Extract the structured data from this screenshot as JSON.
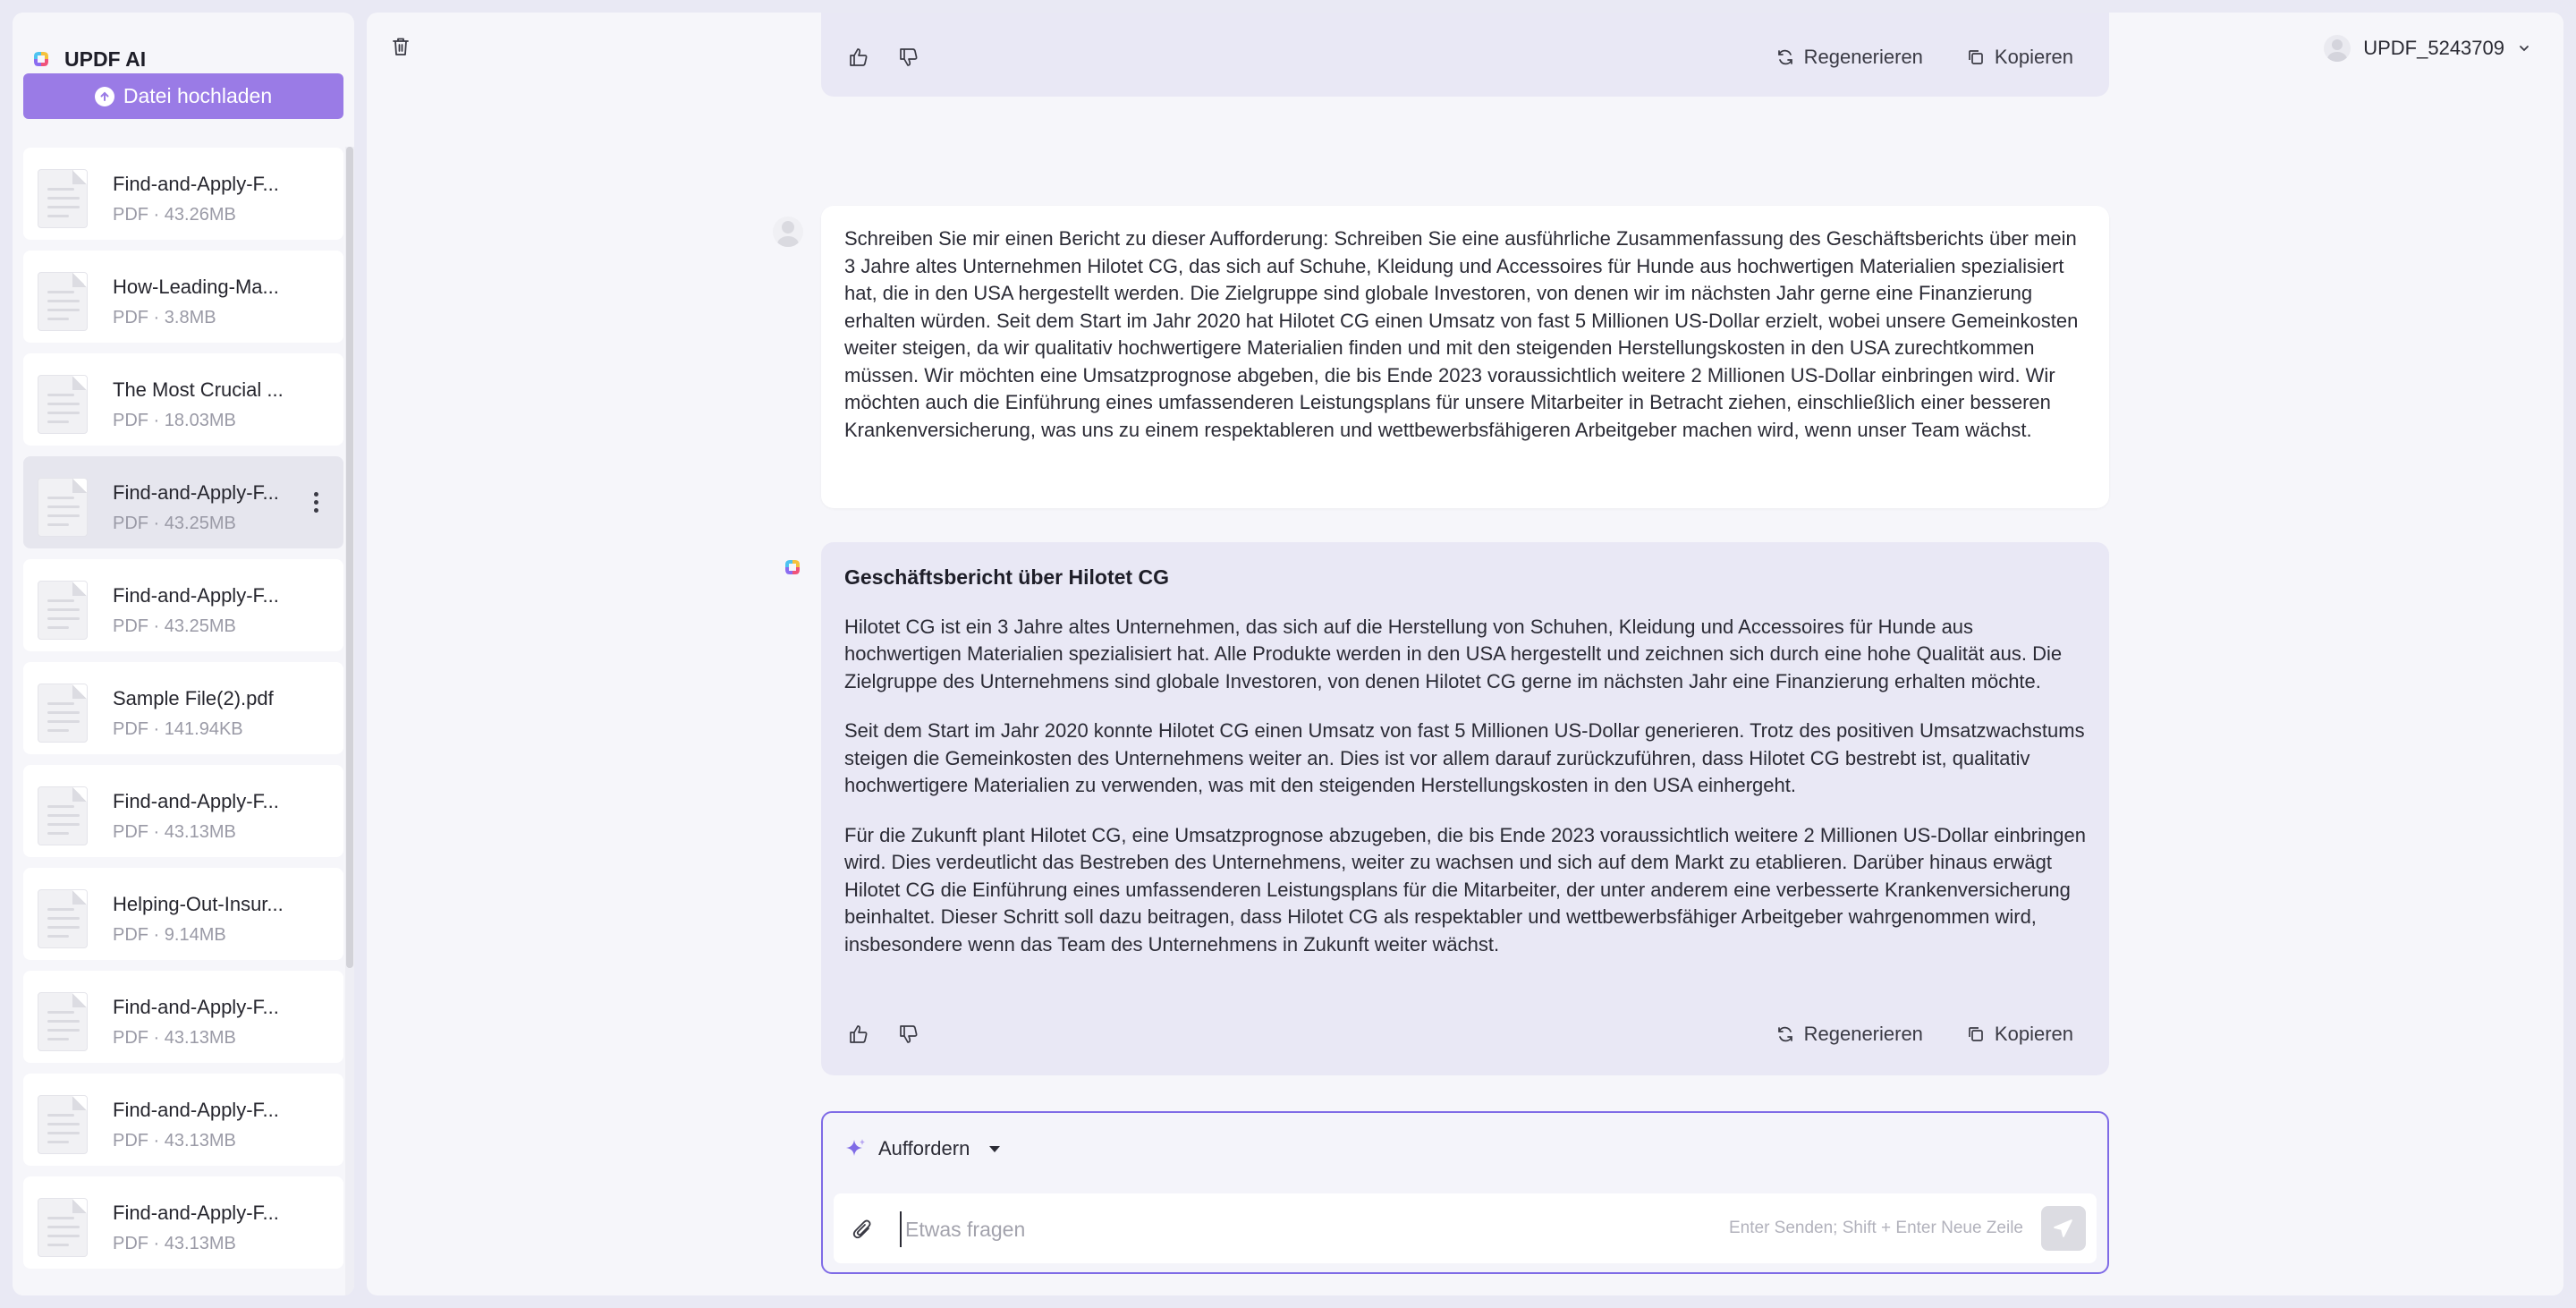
{
  "app": {
    "title": "UPDF AI",
    "upload_label": "Datei hochladen"
  },
  "user": {
    "name": "UPDF_5243709"
  },
  "files": [
    {
      "name": "Find-and-Apply-F...",
      "meta": "PDF · 43.26MB"
    },
    {
      "name": "How-Leading-Ma...",
      "meta": "PDF · 3.8MB"
    },
    {
      "name": "The Most Crucial ...",
      "meta": "PDF · 18.03MB"
    },
    {
      "name": "Find-and-Apply-F...",
      "meta": "PDF · 43.25MB",
      "active": true
    },
    {
      "name": "Find-and-Apply-F...",
      "meta": "PDF · 43.25MB"
    },
    {
      "name": "Sample File(2).pdf",
      "meta": "PDF · 141.94KB"
    },
    {
      "name": "Find-and-Apply-F...",
      "meta": "PDF · 43.13MB"
    },
    {
      "name": "Helping-Out-Insur...",
      "meta": "PDF · 9.14MB"
    },
    {
      "name": "Find-and-Apply-F...",
      "meta": "PDF · 43.13MB"
    },
    {
      "name": "Find-and-Apply-F...",
      "meta": "PDF · 43.13MB"
    },
    {
      "name": "Find-and-Apply-F...",
      "meta": "PDF · 43.13MB"
    }
  ],
  "actions": {
    "regenerate": "Regenerieren",
    "copy": "Kopieren"
  },
  "user_message": "Schreiben Sie mir einen Bericht zu dieser Aufforderung: Schreiben Sie eine ausführliche Zusammenfassung des Geschäftsberichts über mein 3 Jahre altes Unternehmen Hilotet CG, das sich auf Schuhe, Kleidung und Accessoires für Hunde aus hochwertigen Materialien spezialisiert hat, die in den USA hergestellt werden. Die Zielgruppe sind globale Investoren, von denen wir im nächsten Jahr gerne eine Finanzierung erhalten würden. Seit dem Start im Jahr 2020 hat Hilotet CG einen Umsatz von fast 5 Millionen US-Dollar erzielt, wobei unsere Gemeinkosten weiter steigen, da wir qualitativ hochwertigere Materialien finden und mit den steigenden Herstellungskosten in den USA zurechtkommen müssen. Wir möchten eine Umsatzprognose abgeben, die bis Ende 2023 voraussichtlich weitere 2 Millionen US-Dollar einbringen wird. Wir möchten auch die Einführung eines umfassenderen Leistungsplans für unsere Mitarbeiter in Betracht ziehen, einschließlich einer besseren Krankenversicherung, was uns zu einem respektableren und wettbewerbsfähigeren Arbeitgeber machen wird, wenn unser Team wächst.",
  "response": {
    "title": "Geschäftsbericht über Hilotet CG",
    "paragraphs": [
      "Hilotet CG ist ein 3 Jahre altes Unternehmen, das sich auf die Herstellung von Schuhen, Kleidung und Accessoires für Hunde aus hochwertigen Materialien spezialisiert hat. Alle Produkte werden in den USA hergestellt und zeichnen sich durch eine hohe Qualität aus. Die Zielgruppe des Unternehmens sind globale Investoren, von denen Hilotet CG gerne im nächsten Jahr eine Finanzierung erhalten möchte.",
      "Seit dem Start im Jahr 2020 konnte Hilotet CG einen Umsatz von fast 5 Millionen US-Dollar generieren. Trotz des positiven Umsatzwachstums steigen die Gemeinkosten des Unternehmens weiter an. Dies ist vor allem darauf zurückzuführen, dass Hilotet CG bestrebt ist, qualitativ hochwertigere Materialien zu verwenden, was mit den steigenden Herstellungskosten in den USA einhergeht.",
      "Für die Zukunft plant Hilotet CG, eine Umsatzprognose abzugeben, die bis Ende 2023 voraussichtlich weitere 2 Millionen US-Dollar einbringen wird. Dies verdeutlicht das Bestreben des Unternehmens, weiter zu wachsen und sich auf dem Markt zu etablieren. Darüber hinaus erwägt Hilotet CG die Einführung eines umfassenderen Leistungsplans für die Mitarbeiter, der unter anderem eine verbesserte Krankenversicherung beinhaltet. Dieser Schritt soll dazu beitragen, dass Hilotet CG als respektabler und wettbewerbsfähiger Arbeitgeber wahrgenommen wird, insbesondere wenn das Team des Unternehmens in Zukunft weiter wächst."
    ]
  },
  "composer": {
    "mode_label": "Auffordern",
    "placeholder": "Etwas fragen",
    "hint": "Enter Senden; Shift + Enter Neue Zeile"
  },
  "colors": {
    "accent": "#9a7be6",
    "composer_border": "#7f6be6",
    "ai_bubble": "#e9e8f5"
  }
}
